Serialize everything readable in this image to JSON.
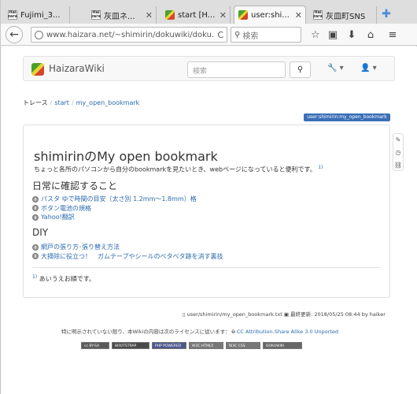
{
  "browser": {
    "tabs": [
      {
        "favicon": "hatena-favicon",
        "title": "Fujimi_3...",
        "active": false
      },
      {
        "favicon": "hatena-favicon",
        "title": "灰皿ネ...",
        "active": false
      },
      {
        "favicon": "dokuwiki-favicon",
        "title": "start [H...",
        "active": false
      },
      {
        "favicon": "dokuwiki-favicon",
        "title": "user:shi...",
        "active": true
      },
      {
        "favicon": "hatena-favicon",
        "title": "灰皿町SNS",
        "active": false
      }
    ],
    "hatena_icon_text": "Hai\nzara",
    "url": "www.haizara.net/~shimirin/dokuwiki/doku.php?id=u",
    "search_placeholder": "検索"
  },
  "site": {
    "title": "HaizaraWiki",
    "search_placeholder": "検索"
  },
  "breadcrumb": {
    "label": "トレース",
    "items": [
      "start",
      "my_open_bookmark"
    ]
  },
  "page_id": "user:shimirin:my_open_bookmark",
  "article": {
    "title": "shimirinのMy open bookmark",
    "intro": "ちょっと各所のパソコンから自分のbookmarkを見たいとき、webページになっていると便利です。",
    "intro_fn": "1)",
    "sections": [
      {
        "heading": "日常に確認すること",
        "links": [
          "パスタ ゆで時間の目安（太さ別 1.2mm〜1.8mm）格",
          "ボタン電池の規格",
          "Yahoo!翻訳"
        ]
      },
      {
        "heading": "DIY",
        "links": [
          "網戸の張り方･張り替え方法",
          "大掃除に役立つ！　ガムテープやシールのベタベタ跡を消す裏技"
        ]
      }
    ],
    "footnote_mark": "1)",
    "footnote_text": "あいうえお順です。"
  },
  "docinfo": {
    "file": "user/shimirin/my_open_bookmark.txt",
    "modified_label": "最終更新:",
    "modified": "2018/05/25 08:44",
    "by": "by haiker"
  },
  "license": {
    "text": "特に明示されていない限り、本Wikiの内容は次のライセンスに従います：",
    "link": "CC Attribution-Share Alike 3.0 Unported"
  },
  "badges": [
    "cc BY-SA",
    "BOOTSTRAP",
    "PHP POWERED",
    "W3C HTML5",
    "W3C CSS",
    "DOKUWIKI"
  ]
}
